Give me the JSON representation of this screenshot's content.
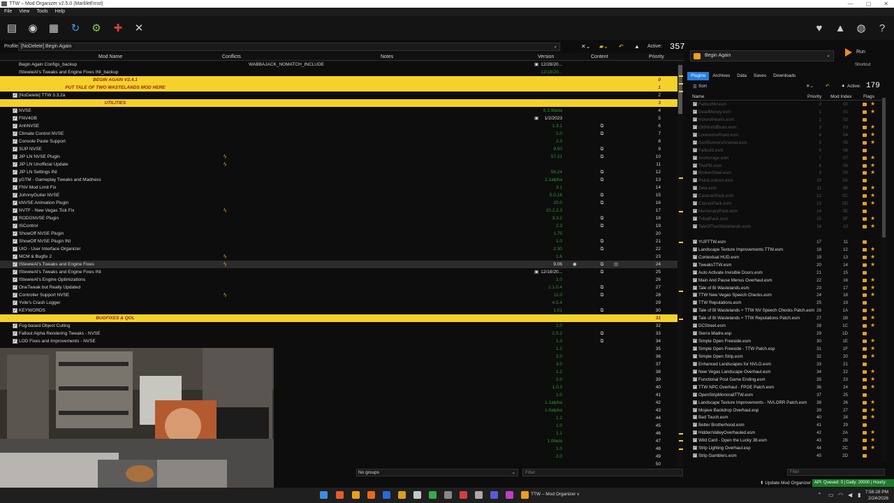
{
  "window": {
    "title": "TTW – Mod Organizer v2.5.0 (MarbleErnst)",
    "buttons": [
      "—",
      "▢",
      "✕"
    ]
  },
  "menu": [
    "File",
    "View",
    "Tools",
    "Help"
  ],
  "profile": {
    "label": "Profile",
    "value": "[NoDelete] Begin Again",
    "active_label": "Active:",
    "active_count": "357"
  },
  "columns": {
    "mod_name": "Mod Name",
    "conflicts": "Conflicts",
    "notes": "Notes",
    "version": "Version",
    "content": "Content",
    "priority": "Priority"
  },
  "mods": [
    {
      "type": "mod",
      "name": "Begin Again Configs_backup",
      "notes": "WABBAJACK_NOMATCH_INCLUDE",
      "version": "12/28/20...",
      "vw": true,
      "pri": ""
    },
    {
      "type": "mod",
      "name": "IStewieAI's Tweaks and Engine Fixes INI_backup",
      "version": "12/18/20...",
      "pri": ""
    },
    {
      "type": "sep",
      "name": "BEGIN AGAIN V2.4.1",
      "pri": "0"
    },
    {
      "type": "sep",
      "name": "PUT TALE OF TWO WASTELANDS MOD HERE",
      "pri": "1",
      "ex": true
    },
    {
      "type": "mod",
      "name": "[NoDelete] TTW 3.3.2a",
      "pri": "2",
      "checked": true
    },
    {
      "type": "sep",
      "name": "UTILITIES",
      "pri": "3"
    },
    {
      "type": "mod",
      "name": "NVSE",
      "version": "6.3.9beta",
      "pri": "4",
      "checked": true
    },
    {
      "type": "mod",
      "name": "FNV4GB",
      "version": "1/2/2023",
      "vw": true,
      "pri": "5",
      "checked": true
    },
    {
      "type": "mod",
      "name": "AnhNVSE",
      "version": "1.3.1",
      "pri": "6",
      "checked": true
    },
    {
      "type": "mod",
      "name": "Climate Control NVSE",
      "version": "1.0",
      "pri": "7",
      "checked": true
    },
    {
      "type": "mod",
      "name": "Console Paste Support",
      "version": "2.3",
      "pri": "8",
      "checked": true
    },
    {
      "type": "mod",
      "name": "SUP NVSE",
      "version": "9.50",
      "pri": "9",
      "checked": true
    },
    {
      "type": "mod",
      "name": "JIP LN NVSE Plugin",
      "version": "57.21",
      "pri": "10",
      "checked": true,
      "conflict": true
    },
    {
      "type": "mod",
      "name": "JIP LN Unofficial Update",
      "version": "",
      "pri": "11",
      "checked": true,
      "conflict": true
    },
    {
      "type": "mod",
      "name": "JIP LN Settings INI",
      "version": "56.24",
      "pri": "12",
      "checked": true
    },
    {
      "type": "mod",
      "name": "yGTM - Gameplay Tweaks and Madness",
      "version": "2.1alpha",
      "pri": "13",
      "checked": true
    },
    {
      "type": "mod",
      "name": "FNV Mod Limit Fix",
      "version": "3.1",
      "pri": "14",
      "checked": true
    },
    {
      "type": "mod",
      "name": "JohnnyGuitar NVSE",
      "version": "5.0.16",
      "pri": "15",
      "checked": true
    },
    {
      "type": "mod",
      "name": "kNVSE Animation Plugin",
      "version": "20.0",
      "pri": "16",
      "checked": true
    },
    {
      "type": "mod",
      "name": "NVTF - New Vegas Tick Fix",
      "version": "10.2.2.3",
      "pri": "17",
      "checked": true,
      "conflict": true
    },
    {
      "type": "mod",
      "name": "RODGNVSE Plugin",
      "version": "3.3.2",
      "pri": "18",
      "checked": true
    },
    {
      "type": "mod",
      "name": "ISControl",
      "version": "2.3",
      "pri": "19",
      "checked": true
    },
    {
      "type": "mod",
      "name": "ShowOff NVSE Plugin",
      "version": "1.75",
      "pri": "20",
      "checked": true
    },
    {
      "type": "mod",
      "name": "ShowOff NVSE Plugin INI",
      "version": "1.0",
      "pri": "21",
      "checked": true
    },
    {
      "type": "mod",
      "name": "UIO - User Interface Organizer",
      "version": "2.30",
      "pri": "22",
      "checked": true
    },
    {
      "type": "mod",
      "name": "MCM & Bugfix 2",
      "version": "1.6",
      "pri": "23",
      "checked": true,
      "conflict": true
    },
    {
      "type": "mod",
      "name": "IStewieAI's Tweaks and Engine Fixes",
      "version": "9.06",
      "vwhite": true,
      "pri": "24",
      "checked": true,
      "conflict": true,
      "sel": true
    },
    {
      "type": "mod",
      "name": "IStewieAI's Tweaks and Engine Fixes INI",
      "version": "12/18/20...",
      "vw": true,
      "pri": "25",
      "checked": true
    },
    {
      "type": "mod",
      "name": "IStewieAI's Engine Optimizations",
      "version": "1.0",
      "pri": "26",
      "checked": true
    },
    {
      "type": "mod",
      "name": "OneTweak but Really Updated",
      "version": "2.1.0.4",
      "pri": "27",
      "checked": true
    },
    {
      "type": "mod",
      "name": "Controller Support NVSE",
      "version": "11.0",
      "pri": "28",
      "checked": true,
      "conflict": true
    },
    {
      "type": "mod",
      "name": "Yvile's Crash Logger",
      "version": "4.5.4",
      "pri": "29",
      "checked": true
    },
    {
      "type": "mod",
      "name": "KEYWORDS",
      "version": "1.01",
      "pri": "30",
      "checked": true
    },
    {
      "type": "sep",
      "name": "BUGFIXES & QOL",
      "pri": "31",
      "ex": true
    },
    {
      "type": "mod",
      "name": "Fog-based Object Culling",
      "version": "2.0",
      "pri": "32",
      "checked": true
    },
    {
      "type": "mod",
      "name": "Fallout Alpha Rendering Tweaks - NVSE",
      "version": "2.5.2",
      "pri": "33",
      "checked": true
    },
    {
      "type": "mod",
      "name": "LOD Fixes and Improvements - NVSE",
      "version": "1.3",
      "pri": "34",
      "checked": true
    },
    {
      "type": "mod",
      "name": "",
      "version": "1.2",
      "pri": "35"
    },
    {
      "type": "mod",
      "name": "",
      "version": "2.0",
      "pri": "36"
    },
    {
      "type": "mod",
      "name": "",
      "version": "3.0",
      "pri": "37"
    },
    {
      "type": "mod",
      "name": "",
      "version": "1.2",
      "pri": "38"
    },
    {
      "type": "mod",
      "name": "",
      "version": "2.0",
      "pri": "39"
    },
    {
      "type": "mod",
      "name": "",
      "version": "1.0.3",
      "pri": "40"
    },
    {
      "type": "mod",
      "name": "",
      "version": "1.0",
      "pri": "41"
    },
    {
      "type": "mod",
      "name": "",
      "version": "1.1alpha",
      "pri": "42"
    },
    {
      "type": "mod",
      "name": "",
      "version": "1.0alpha",
      "pri": "43"
    },
    {
      "type": "mod",
      "name": "",
      "version": "1.2",
      "pri": "44"
    },
    {
      "type": "mod",
      "name": "",
      "version": "1.0",
      "pri": "45"
    },
    {
      "type": "mod",
      "name": "",
      "version": "1.1",
      "pri": "46"
    },
    {
      "type": "mod",
      "name": "",
      "version": "1.0beta",
      "pri": "47"
    },
    {
      "type": "mod",
      "name": "",
      "version": "1.0",
      "pri": "48"
    },
    {
      "type": "mod",
      "name": "",
      "version": "2.0",
      "pri": "49"
    },
    {
      "type": "mod",
      "name": "",
      "version": "",
      "pri": "50"
    }
  ],
  "bottom": {
    "groups": "No groups",
    "filter_placeholder": "Filter"
  },
  "right": {
    "profile_button": "Begin Again",
    "run": "Run",
    "shortcut": "Shortcut",
    "tabs": [
      "Plugins",
      "Archives",
      "Data",
      "Saves",
      "Downloads"
    ],
    "sort": "Sort",
    "active_label": "Active:",
    "active_count": "179",
    "columns": {
      "name": "Name",
      "priority": "Priority",
      "mod_index": "Mod Index",
      "flags": "Flags"
    },
    "filter_placeholder": "Filter"
  },
  "plugins": [
    {
      "name": "FalloutNV.esm",
      "p": "0",
      "i": "00",
      "dim": true
    },
    {
      "name": "DeadMoney.esm",
      "p": "1",
      "i": "01",
      "dim": true
    },
    {
      "name": "HonestHearts.esm",
      "p": "2",
      "i": "02",
      "dim": true
    },
    {
      "name": "OldWorldBlues.esm",
      "p": "3",
      "i": "03",
      "dim": true
    },
    {
      "name": "LonesomeRoad.esm",
      "p": "4",
      "i": "04",
      "dim": true
    },
    {
      "name": "GunRunnersArsenal.esm",
      "p": "5",
      "i": "05",
      "dim": true
    },
    {
      "name": "Fallout3.esm",
      "p": "6",
      "i": "06",
      "dim": true
    },
    {
      "name": "Anchorage.esm",
      "p": "7",
      "i": "07",
      "dim": true
    },
    {
      "name": "ThePitt.esm",
      "p": "8",
      "i": "08",
      "dim": true
    },
    {
      "name": "BrokenSteel.esm",
      "p": "9",
      "i": "09",
      "dim": true
    },
    {
      "name": "PointLookout.esm",
      "p": "10",
      "i": "0A",
      "dim": true
    },
    {
      "name": "Zeta.esm",
      "p": "11",
      "i": "0B",
      "dim": true
    },
    {
      "name": "CaravanPack.esm",
      "p": "12",
      "i": "0C",
      "dim": true
    },
    {
      "name": "ClassicPack.esm",
      "p": "13",
      "i": "0D",
      "dim": true
    },
    {
      "name": "MercenaryPack.esm",
      "p": "14",
      "i": "0E",
      "dim": true
    },
    {
      "name": "TribalPack.esm",
      "p": "15",
      "i": "0F",
      "dim": true
    },
    {
      "name": "TaleOfTwoWastelands.esm",
      "p": "16",
      "i": "10",
      "dim": true
    },
    {
      "name": "",
      "p": "",
      "i": ""
    },
    {
      "name": "YUPTTW.esm",
      "p": "17",
      "i": "11"
    },
    {
      "name": "Landscape Texture Improvements TTW.esm",
      "p": "18",
      "i": "12"
    },
    {
      "name": "Contextual HUD.esm",
      "p": "19",
      "i": "13"
    },
    {
      "name": "TweaksTTW.esm",
      "p": "20",
      "i": "14"
    },
    {
      "name": "Auto Activate Invisible Doors.esm",
      "p": "21",
      "i": "15"
    },
    {
      "name": "Main And Pause Menus Overhaul.esm",
      "p": "22",
      "i": "16"
    },
    {
      "name": "Tale of Bi Wastelands.esm",
      "p": "23",
      "i": "17"
    },
    {
      "name": "TTW New Vegas Speech Checks.esm",
      "p": "24",
      "i": "18"
    },
    {
      "name": "TTW Reputations.esm",
      "p": "25",
      "i": "19"
    },
    {
      "name": "Tale of Bi Wastelands + TTW NV Speech Checks Patch.esm",
      "p": "26",
      "i": "1A"
    },
    {
      "name": "Tale of Bi Wastelands + TTW Reputations Patch.esm",
      "p": "27",
      "i": "1B"
    },
    {
      "name": "DCStreet.esm",
      "p": "28",
      "i": "1C"
    },
    {
      "name": "Sierra Madre.esp",
      "p": "29",
      "i": "1D"
    },
    {
      "name": "Simple Open Freeside.esm",
      "p": "30",
      "i": "1E"
    },
    {
      "name": "Simple Open Freeside - TTW Patch.esp",
      "p": "31",
      "i": "1F"
    },
    {
      "name": "Simple Open Strip.esm",
      "p": "32",
      "i": "20"
    },
    {
      "name": "Enhanced Landscapes for NVLO.esm",
      "p": "33",
      "i": "21"
    },
    {
      "name": "New Vegas Landscape Overhaul.esm",
      "p": "34",
      "i": "22"
    },
    {
      "name": "Functional Post Game Ending.esm",
      "p": "35",
      "i": "23"
    },
    {
      "name": "TTW NPC Overhaul - FPGE Patch.esm",
      "p": "36",
      "i": "24"
    },
    {
      "name": "OpenStripMonorailTTW.esm",
      "p": "37",
      "i": "25"
    },
    {
      "name": "Landscape Texture Improvements - NVLORR Patch.esm",
      "p": "38",
      "i": "26"
    },
    {
      "name": "Mojave Backdrop Overhaul.esp",
      "p": "39",
      "i": "27"
    },
    {
      "name": "Bad Touch.esm",
      "p": "40",
      "i": "28"
    },
    {
      "name": "Better Brotherhood.esm",
      "p": "41",
      "i": "29"
    },
    {
      "name": "HiddenValleyOverhauled.esm",
      "p": "42",
      "i": "2A"
    },
    {
      "name": "Wild Card - Open the Lucky 38.esm",
      "p": "43",
      "i": "2B"
    },
    {
      "name": "Strip Lighting Overhaul.esp",
      "p": "44",
      "i": "2C"
    },
    {
      "name": "Strip Gamblers.esm",
      "p": "45",
      "i": "2D"
    }
  ],
  "status": {
    "update": "Update Mod Organizer",
    "api": "API: Queued: 0 | Daily: 20000 | Hourly: 500"
  },
  "taskbar": {
    "app": "TTW – Mod Organizer v",
    "time": "7:56:28 PM",
    "date": "2/24/2026"
  },
  "colors": {
    "separator": "#f5d229",
    "separator_text": "#9a2222",
    "version": "#2a9a2a",
    "accent": "#2a7be0",
    "run": "#f08a20"
  }
}
